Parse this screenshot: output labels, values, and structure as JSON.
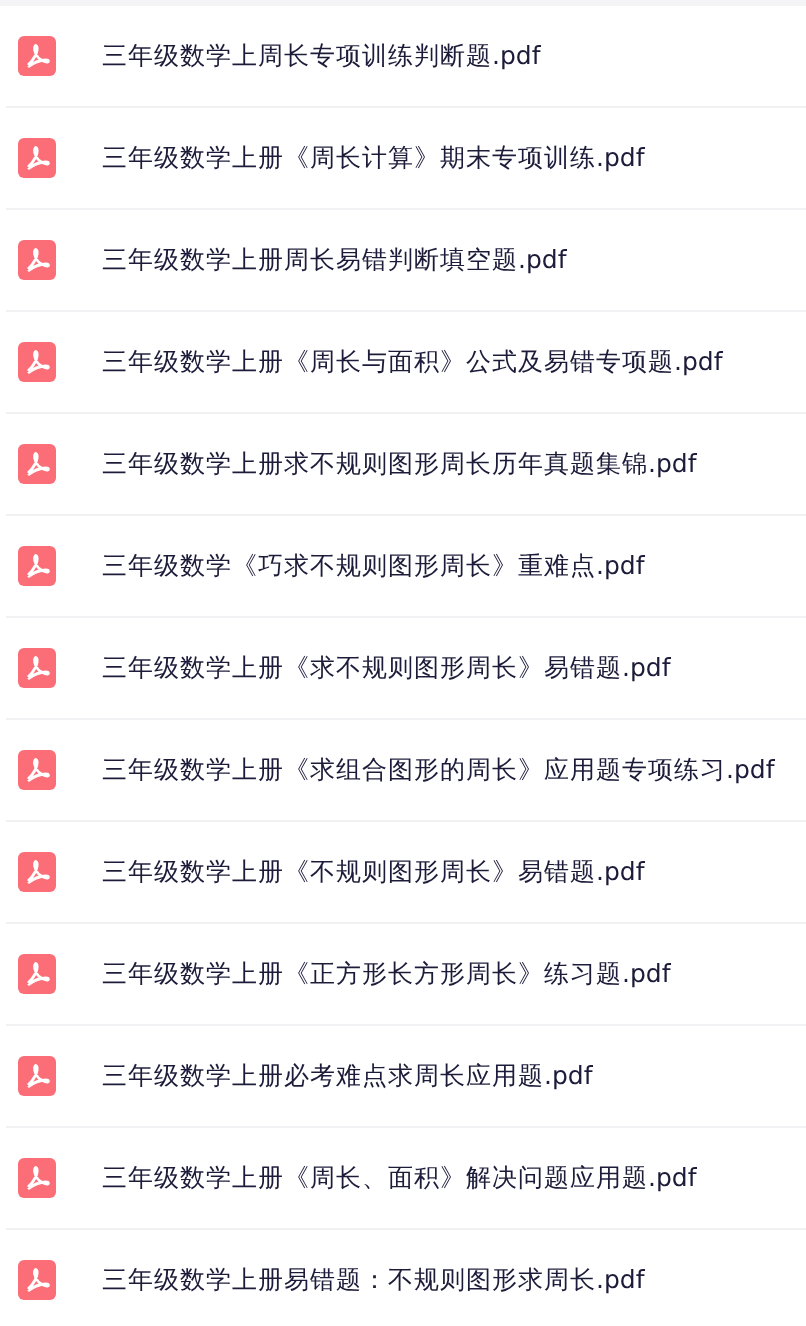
{
  "files": [
    {
      "name": "三年级数学上周长专项训练判断题.pdf"
    },
    {
      "name": "三年级数学上册《周长计算》期末专项训练.pdf"
    },
    {
      "name": "三年级数学上册周长易错判断填空题.pdf"
    },
    {
      "name": "三年级数学上册《周长与面积》公式及易错专项题.pdf"
    },
    {
      "name": "三年级数学上册求不规则图形周长历年真题集锦.pdf"
    },
    {
      "name": "三年级数学《巧求不规则图形周长》重难点.pdf"
    },
    {
      "name": "三年级数学上册《求不规则图形周长》易错题.pdf"
    },
    {
      "name": "三年级数学上册《求组合图形的周长》应用题专项练习.pdf"
    },
    {
      "name": "三年级数学上册《不规则图形周长》易错题.pdf"
    },
    {
      "name": "三年级数学上册《正方形长方形周长》练习题.pdf"
    },
    {
      "name": "三年级数学上册必考难点求周长应用题.pdf"
    },
    {
      "name": "三年级数学上册《周长、面积》解决问题应用题.pdf"
    },
    {
      "name": "三年级数学上册易错题：不规则图形求周长.pdf"
    }
  ]
}
